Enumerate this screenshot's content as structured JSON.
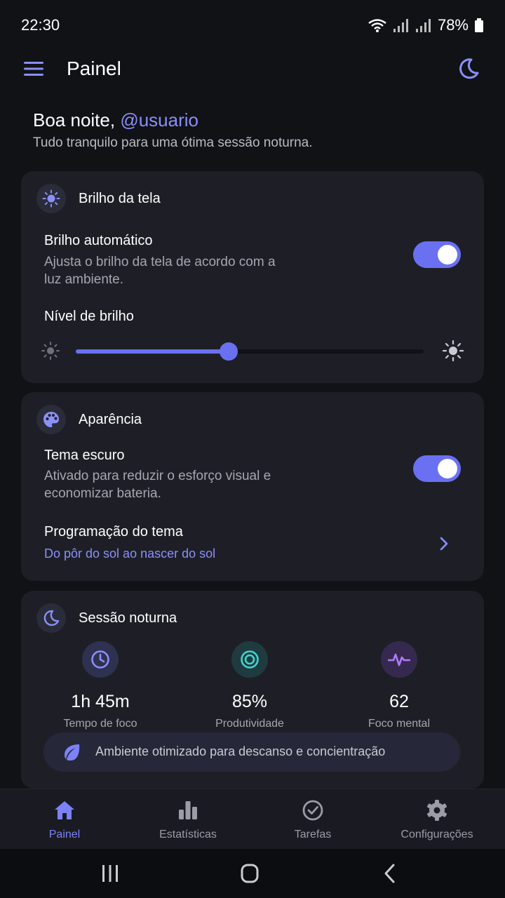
{
  "status": {
    "time": "22:30",
    "battery": "78%"
  },
  "header": {
    "title": "Painel"
  },
  "greeting": {
    "prefix": "Boa noite, ",
    "handle": "@usuario",
    "subtitle": "Tudo tranquilo para uma ótima sessão noturna."
  },
  "brightness": {
    "title": "Brilho da tela",
    "auto_title": "Brilho automático",
    "auto_desc": "Ajusta o brilho da tela de acordo com a luz ambiente.",
    "auto_enabled": true,
    "level_title": "Nível de brilho",
    "level": 0.44
  },
  "appearance": {
    "title": "Aparência",
    "dark_title": "Tema escuro",
    "dark_desc": "Ativado para reduzir o esforço visual e economizar bateria.",
    "dark_enabled": true,
    "schedule_title": "Programação do tema",
    "schedule_value": "Do pôr do sol ao nascer do sol"
  },
  "session": {
    "title": "Sessão noturna",
    "stats": [
      {
        "value": "1h 45m",
        "label": "Tempo de foco",
        "icon": "clock-icon",
        "color": "#8b8ff8"
      },
      {
        "value": "85%",
        "label": "Produtividade",
        "icon": "target-icon",
        "color": "#3ed6d0"
      },
      {
        "value": "62",
        "label": "Foco mental",
        "icon": "pulse-icon",
        "color": "#b07cf7"
      }
    ],
    "ambient": "Ambiente otimizado para descanso e concientração"
  },
  "nav": [
    {
      "label": "Painel",
      "icon": "home-icon",
      "active": true
    },
    {
      "label": "Estatísticas",
      "icon": "bar-chart-icon",
      "active": false
    },
    {
      "label": "Tarefas",
      "icon": "check-circle-icon",
      "active": false
    },
    {
      "label": "Configurações",
      "icon": "gear-icon",
      "active": false
    }
  ],
  "colors": {
    "accent": "#6a70f2",
    "background": "#111216",
    "card": "#1e1f26"
  }
}
